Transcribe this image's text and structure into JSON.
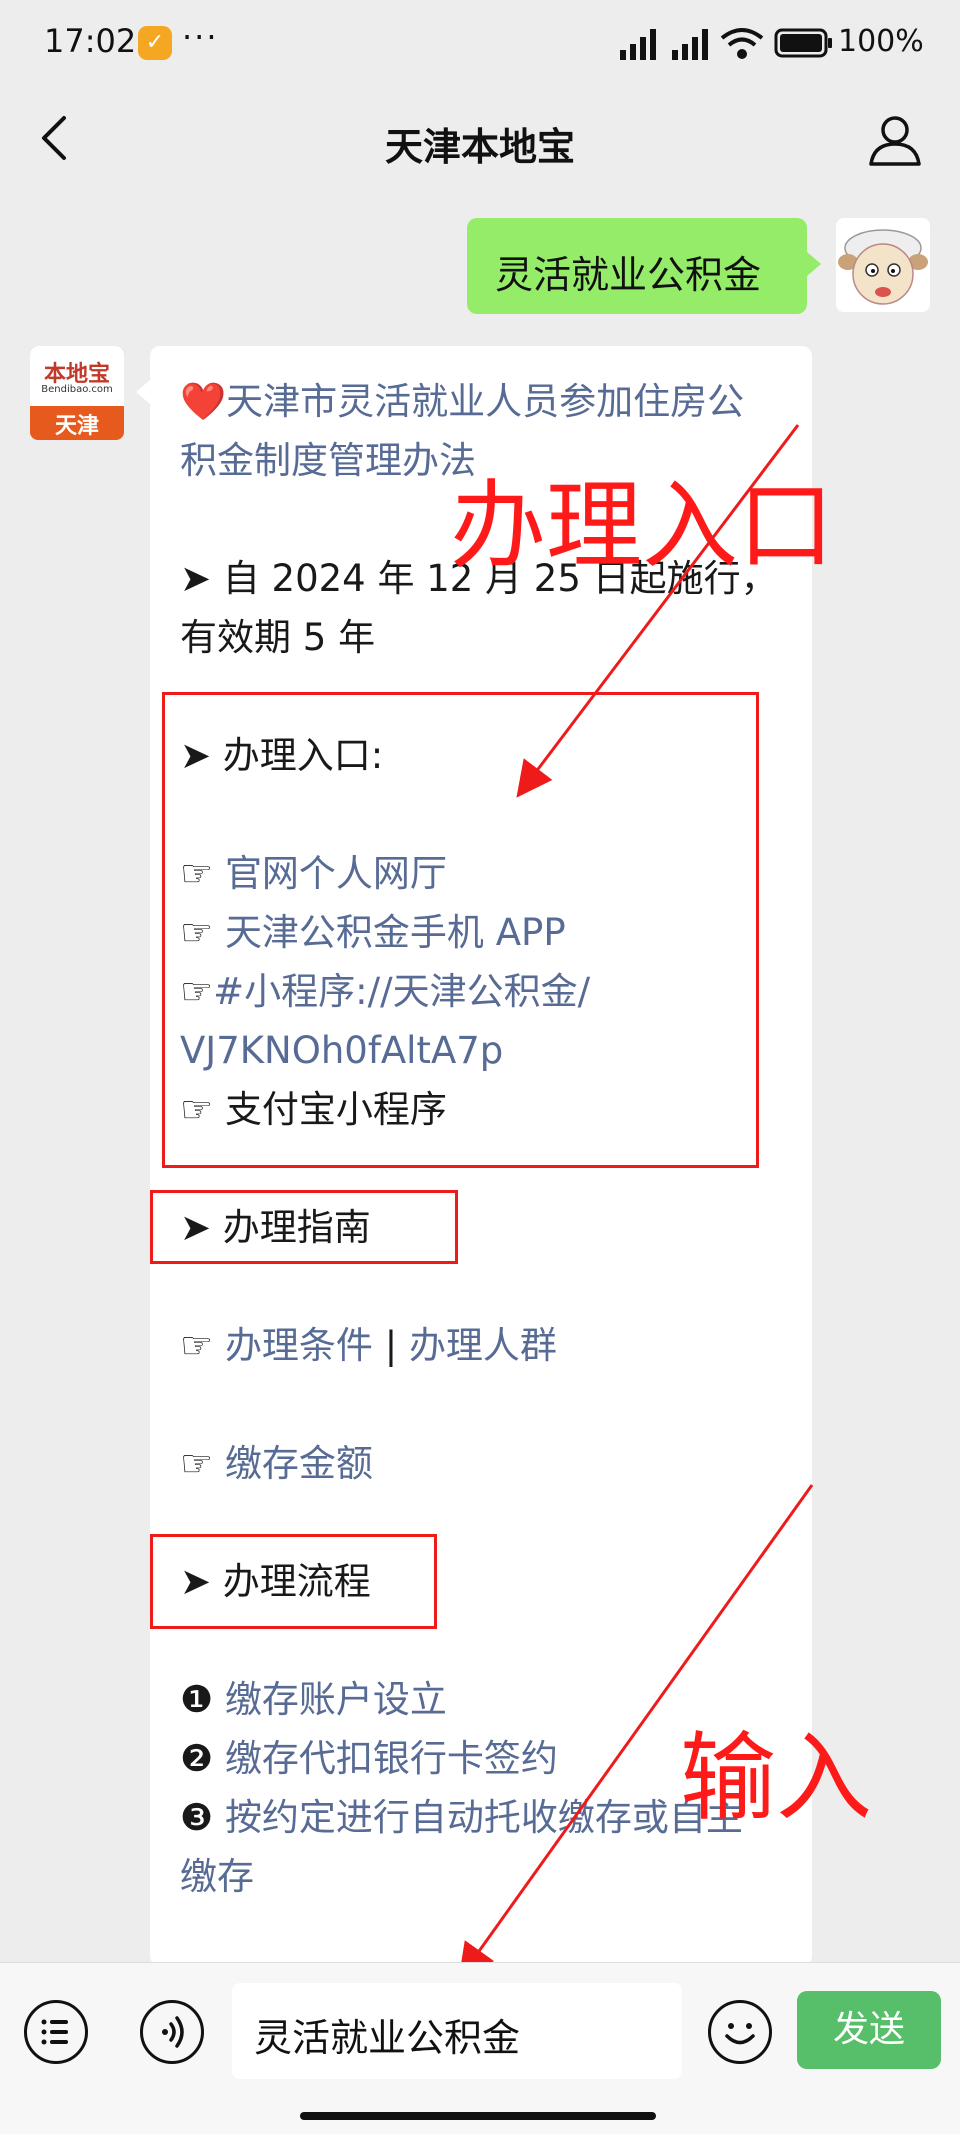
{
  "status_bar": {
    "time": "17:02",
    "dots": "···",
    "battery": "100%"
  },
  "nav": {
    "title": "天津本地宝"
  },
  "sent": {
    "text": "灵活就业公积金"
  },
  "received": {
    "avatar_brand": "本地宝",
    "avatar_site": "Bendibao.com",
    "avatar_city": "天津",
    "heart": "❤️",
    "title_line1": "天津市灵活就业人员参加住房公",
    "title_line2": "积金制度管理办法",
    "effective_line1": "➤ 自 2024 年 12 月 25 日起施行，",
    "effective_line2": "有效期 5 年",
    "entry_heading": "➤ 办理入口:",
    "hand": "☞",
    "entry_items": [
      "官网个人网厅",
      "天津公积金手机 APP",
      "#小程序://天津公积金/",
      "VJ7KNOh0fAltA7p",
      "支付宝小程序"
    ],
    "guide_heading": "➤ 办理指南",
    "guide_cond": "办理条件",
    "separator": "|",
    "guide_people": "办理人群",
    "guide_amount": "缴存金额",
    "process_heading": "➤ 办理流程",
    "steps": [
      "❶",
      "❷",
      "❸"
    ],
    "step1": "缴存账户设立",
    "step2": "缴存代扣银行卡签约",
    "step3_line1": "按约定进行自动托收缴存或自主",
    "step3_line2": "缴存"
  },
  "annotations": {
    "entry_label": "办理入口",
    "input_label": "输入"
  },
  "input_bar": {
    "input_value": "灵活就业公积金",
    "send_label": "发送"
  },
  "colors": {
    "link": "#576b95",
    "sent_bubble": "#95ec69",
    "send_button": "#57be6a",
    "annotation": "#ef1b1b"
  }
}
